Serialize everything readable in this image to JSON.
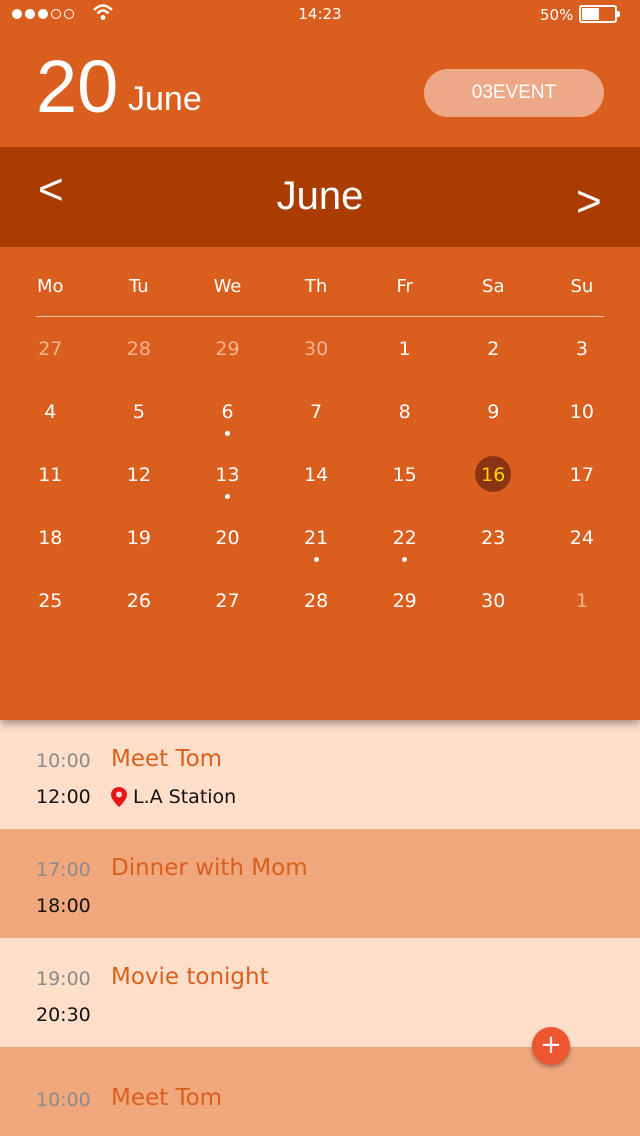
{
  "status": {
    "time": "14:23",
    "battery": "50%",
    "signal_bars": 3,
    "battery_level": 0.5
  },
  "header": {
    "day": "20",
    "month": "June",
    "event_button": "03EVENT"
  },
  "nav": {
    "prev": "<",
    "month": "June",
    "next": ">"
  },
  "weekdays": [
    "Mo",
    "Tu",
    "We",
    "Th",
    "Fr",
    "Sa",
    "Su"
  ],
  "weeks": [
    [
      {
        "d": "27",
        "m": 1
      },
      {
        "d": "28",
        "m": 1
      },
      {
        "d": "29",
        "m": 1
      },
      {
        "d": "30",
        "m": 1
      },
      {
        "d": "1"
      },
      {
        "d": "2"
      },
      {
        "d": "3"
      }
    ],
    [
      {
        "d": "4"
      },
      {
        "d": "5"
      },
      {
        "d": "6",
        "dot": 1
      },
      {
        "d": "7"
      },
      {
        "d": "8"
      },
      {
        "d": "9"
      },
      {
        "d": "10"
      }
    ],
    [
      {
        "d": "11"
      },
      {
        "d": "12"
      },
      {
        "d": "13",
        "dot": 1
      },
      {
        "d": "14"
      },
      {
        "d": "15"
      },
      {
        "d": "16",
        "today": 1
      },
      {
        "d": "17"
      }
    ],
    [
      {
        "d": "18"
      },
      {
        "d": "19"
      },
      {
        "d": "20"
      },
      {
        "d": "21",
        "dot": 1
      },
      {
        "d": "22",
        "dot": 1
      },
      {
        "d": "23"
      },
      {
        "d": "24"
      }
    ],
    [
      {
        "d": "25"
      },
      {
        "d": "26"
      },
      {
        "d": "27"
      },
      {
        "d": "28"
      },
      {
        "d": "29"
      },
      {
        "d": "30"
      },
      {
        "d": "1",
        "m": 1
      }
    ]
  ],
  "events": [
    {
      "start": "10:00",
      "end": "12:00",
      "title": "Meet Tom",
      "location": "L.A Station"
    },
    {
      "start": "17:00",
      "end": "18:00",
      "title": "Dinner with Mom"
    },
    {
      "start": "19:00",
      "end": "20:30",
      "title": "Movie tonight"
    },
    {
      "start": "10:00",
      "title": "Meet Tom"
    }
  ],
  "fab": "+",
  "colors": {
    "accent": "#da5f1e",
    "month_bar": "#aa3c00",
    "today_text": "#ffd400",
    "pin": "#e81818"
  },
  "icons": {
    "wifi": "wifi-icon",
    "battery": "battery-icon",
    "pin": "location-pin-icon"
  }
}
